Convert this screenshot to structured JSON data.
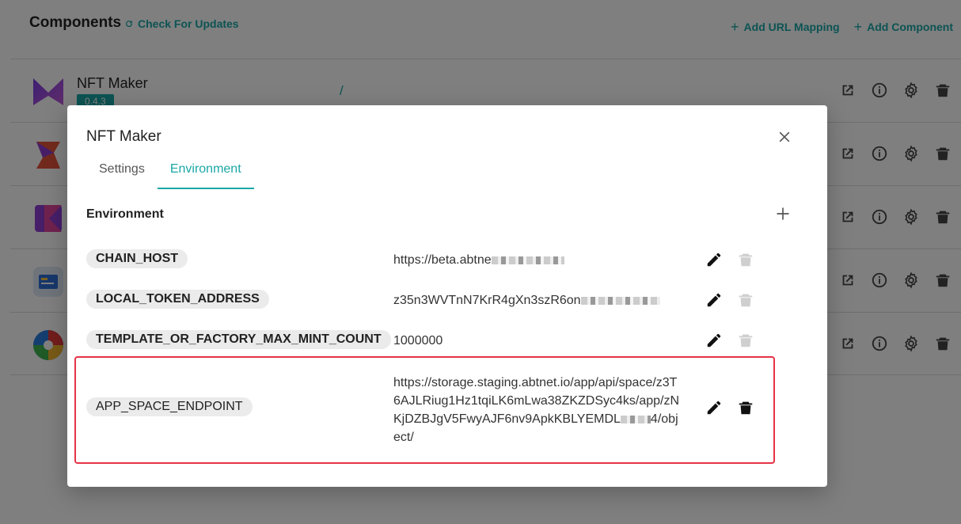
{
  "page": {
    "title": "Components",
    "check_updates": "Check For Updates",
    "add_url_mapping": "Add URL Mapping",
    "add_component": "Add Component"
  },
  "components": [
    {
      "name": "NFT Maker",
      "version": "0.4.3",
      "mount": "/",
      "logo": "nft-maker-logo"
    },
    {
      "name": "",
      "version": "",
      "mount": "",
      "logo": "s-logo"
    },
    {
      "name": "",
      "version": "",
      "mount": "",
      "logo": "k-logo"
    },
    {
      "name": "",
      "version": "",
      "mount": "",
      "logo": "card-logo"
    },
    {
      "name": "",
      "version": "",
      "mount": "",
      "logo": "aperture-logo"
    }
  ],
  "row_action_icons": [
    "open-external-icon",
    "info-icon",
    "gear-icon",
    "trash-icon"
  ],
  "modal": {
    "title": "NFT Maker",
    "tabs": [
      {
        "label": "Settings",
        "active": false
      },
      {
        "label": "Environment",
        "active": true
      }
    ],
    "section_title": "Environment",
    "env": [
      {
        "key": "CHAIN_HOST",
        "value": "https://beta.abtne",
        "blurred": true
      },
      {
        "key": "LOCAL_TOKEN_ADDRESS",
        "value": "z35n3WVTnN7KrR4gXn3szR6on",
        "blurred": true
      },
      {
        "key": "TEMPLATE_OR_FACTORY_MAX_MINT_COUNT",
        "value": "1000000",
        "blurred": false
      },
      {
        "key": "APP_SPACE_ENDPOINT",
        "value_parts": [
          "https://storage.staging.abtnet.io/app/api/space/z3T6AJLRiug1Hz1tqiLK6mLwa38ZKZDSyc4ks/app/zNKjDZBJgV5FwyAJF6nv9ApkKBLYEMDL",
          "4/object/"
        ],
        "blurred": true
      }
    ]
  },
  "colors": {
    "accent": "#1aa7a7",
    "highlight": "#e53346",
    "overlay": "rgba(0,0,0,0.5)"
  }
}
